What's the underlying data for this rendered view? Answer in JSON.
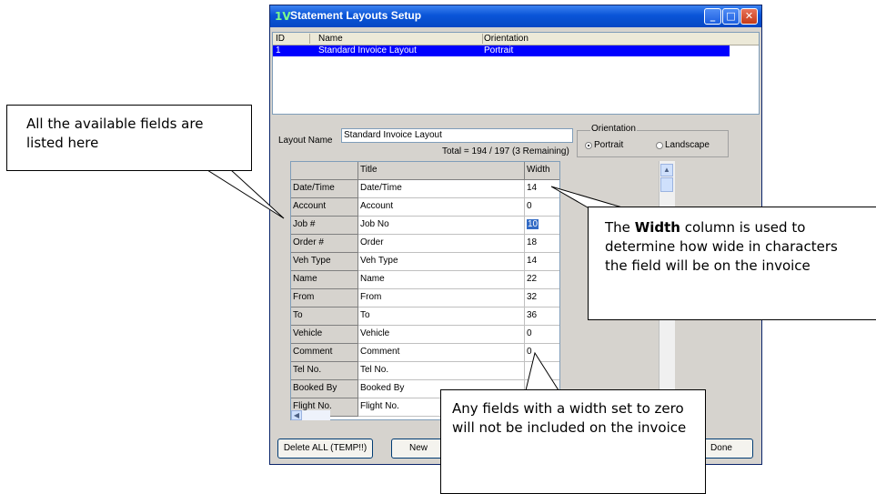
{
  "window": {
    "title": "Statement Layouts Setup",
    "app_icon": "1V",
    "controls": {
      "minimize": "_",
      "maximize": "□",
      "close": "✕"
    }
  },
  "list": {
    "headers": [
      "ID",
      "Name",
      "Orientation"
    ],
    "rows": [
      {
        "id": "1",
        "name": "Standard Invoice Layout",
        "orientation": "Portrait"
      }
    ]
  },
  "layout_name_label": "Layout Name",
  "layout_name_value": "Standard Invoice Layout",
  "total_text": "Total = 194 / 197 (3 Remaining)",
  "orientation": {
    "label": "Orientation",
    "options": [
      "Portrait",
      "Landscape"
    ],
    "selected": "Portrait"
  },
  "grid": {
    "headers": [
      "Title",
      "Width"
    ],
    "rows": [
      {
        "field": "Date/Time",
        "title": "Date/Time",
        "width": "14"
      },
      {
        "field": "Account",
        "title": "Account",
        "width": "0"
      },
      {
        "field": "Job #",
        "title": "Job No",
        "width": "10"
      },
      {
        "field": "Order #",
        "title": "Order",
        "width": "18"
      },
      {
        "field": "Veh Type",
        "title": "Veh Type",
        "width": "14"
      },
      {
        "field": "Name",
        "title": "Name",
        "width": "22"
      },
      {
        "field": "From",
        "title": "From",
        "width": "32"
      },
      {
        "field": "To",
        "title": "To",
        "width": "36"
      },
      {
        "field": "Vehicle",
        "title": "Vehicle",
        "width": "0"
      },
      {
        "field": "Comment",
        "title": "Comment",
        "width": "0"
      },
      {
        "field": "Tel No.",
        "title": "Tel No.",
        "width": ""
      },
      {
        "field": "Booked By",
        "title": "Booked By",
        "width": ""
      },
      {
        "field": "Flight No.",
        "title": "Flight No.",
        "width": ""
      }
    ]
  },
  "buttons": {
    "delete_all": "Delete ALL (TEMP!!)",
    "new": "New",
    "done": "Done"
  },
  "callouts": {
    "fields": "All the available fields are listed here",
    "width_prefix": "The",
    "width_bold": "Width",
    "width_suffix": "column is used to determine how wide in characters the field will be on the invoice",
    "zero": "Any fields with a width set to zero will not be included on the invoice"
  }
}
